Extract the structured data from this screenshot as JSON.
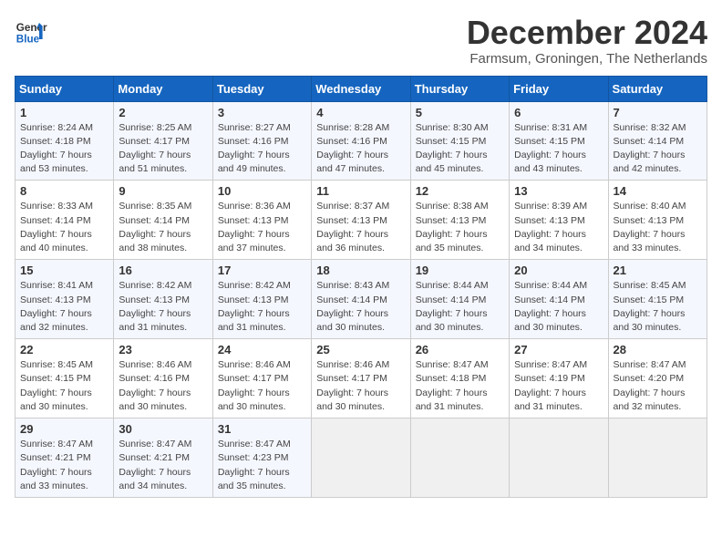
{
  "header": {
    "logo_line1": "General",
    "logo_line2": "Blue",
    "title": "December 2024",
    "subtitle": "Farmsum, Groningen, The Netherlands"
  },
  "weekdays": [
    "Sunday",
    "Monday",
    "Tuesday",
    "Wednesday",
    "Thursday",
    "Friday",
    "Saturday"
  ],
  "weeks": [
    [
      {
        "day": "1",
        "sunrise": "8:24 AM",
        "sunset": "4:18 PM",
        "daylight": "7 hours and 53 minutes."
      },
      {
        "day": "2",
        "sunrise": "8:25 AM",
        "sunset": "4:17 PM",
        "daylight": "7 hours and 51 minutes."
      },
      {
        "day": "3",
        "sunrise": "8:27 AM",
        "sunset": "4:16 PM",
        "daylight": "7 hours and 49 minutes."
      },
      {
        "day": "4",
        "sunrise": "8:28 AM",
        "sunset": "4:16 PM",
        "daylight": "7 hours and 47 minutes."
      },
      {
        "day": "5",
        "sunrise": "8:30 AM",
        "sunset": "4:15 PM",
        "daylight": "7 hours and 45 minutes."
      },
      {
        "day": "6",
        "sunrise": "8:31 AM",
        "sunset": "4:15 PM",
        "daylight": "7 hours and 43 minutes."
      },
      {
        "day": "7",
        "sunrise": "8:32 AM",
        "sunset": "4:14 PM",
        "daylight": "7 hours and 42 minutes."
      }
    ],
    [
      {
        "day": "8",
        "sunrise": "8:33 AM",
        "sunset": "4:14 PM",
        "daylight": "7 hours and 40 minutes."
      },
      {
        "day": "9",
        "sunrise": "8:35 AM",
        "sunset": "4:14 PM",
        "daylight": "7 hours and 38 minutes."
      },
      {
        "day": "10",
        "sunrise": "8:36 AM",
        "sunset": "4:13 PM",
        "daylight": "7 hours and 37 minutes."
      },
      {
        "day": "11",
        "sunrise": "8:37 AM",
        "sunset": "4:13 PM",
        "daylight": "7 hours and 36 minutes."
      },
      {
        "day": "12",
        "sunrise": "8:38 AM",
        "sunset": "4:13 PM",
        "daylight": "7 hours and 35 minutes."
      },
      {
        "day": "13",
        "sunrise": "8:39 AM",
        "sunset": "4:13 PM",
        "daylight": "7 hours and 34 minutes."
      },
      {
        "day": "14",
        "sunrise": "8:40 AM",
        "sunset": "4:13 PM",
        "daylight": "7 hours and 33 minutes."
      }
    ],
    [
      {
        "day": "15",
        "sunrise": "8:41 AM",
        "sunset": "4:13 PM",
        "daylight": "7 hours and 32 minutes."
      },
      {
        "day": "16",
        "sunrise": "8:42 AM",
        "sunset": "4:13 PM",
        "daylight": "7 hours and 31 minutes."
      },
      {
        "day": "17",
        "sunrise": "8:42 AM",
        "sunset": "4:13 PM",
        "daylight": "7 hours and 31 minutes."
      },
      {
        "day": "18",
        "sunrise": "8:43 AM",
        "sunset": "4:14 PM",
        "daylight": "7 hours and 30 minutes."
      },
      {
        "day": "19",
        "sunrise": "8:44 AM",
        "sunset": "4:14 PM",
        "daylight": "7 hours and 30 minutes."
      },
      {
        "day": "20",
        "sunrise": "8:44 AM",
        "sunset": "4:14 PM",
        "daylight": "7 hours and 30 minutes."
      },
      {
        "day": "21",
        "sunrise": "8:45 AM",
        "sunset": "4:15 PM",
        "daylight": "7 hours and 30 minutes."
      }
    ],
    [
      {
        "day": "22",
        "sunrise": "8:45 AM",
        "sunset": "4:15 PM",
        "daylight": "7 hours and 30 minutes."
      },
      {
        "day": "23",
        "sunrise": "8:46 AM",
        "sunset": "4:16 PM",
        "daylight": "7 hours and 30 minutes."
      },
      {
        "day": "24",
        "sunrise": "8:46 AM",
        "sunset": "4:17 PM",
        "daylight": "7 hours and 30 minutes."
      },
      {
        "day": "25",
        "sunrise": "8:46 AM",
        "sunset": "4:17 PM",
        "daylight": "7 hours and 30 minutes."
      },
      {
        "day": "26",
        "sunrise": "8:47 AM",
        "sunset": "4:18 PM",
        "daylight": "7 hours and 31 minutes."
      },
      {
        "day": "27",
        "sunrise": "8:47 AM",
        "sunset": "4:19 PM",
        "daylight": "7 hours and 31 minutes."
      },
      {
        "day": "28",
        "sunrise": "8:47 AM",
        "sunset": "4:20 PM",
        "daylight": "7 hours and 32 minutes."
      }
    ],
    [
      {
        "day": "29",
        "sunrise": "8:47 AM",
        "sunset": "4:21 PM",
        "daylight": "7 hours and 33 minutes."
      },
      {
        "day": "30",
        "sunrise": "8:47 AM",
        "sunset": "4:21 PM",
        "daylight": "7 hours and 34 minutes."
      },
      {
        "day": "31",
        "sunrise": "8:47 AM",
        "sunset": "4:23 PM",
        "daylight": "7 hours and 35 minutes."
      },
      null,
      null,
      null,
      null
    ]
  ],
  "labels": {
    "sunrise": "Sunrise:",
    "sunset": "Sunset:",
    "daylight": "Daylight:"
  }
}
